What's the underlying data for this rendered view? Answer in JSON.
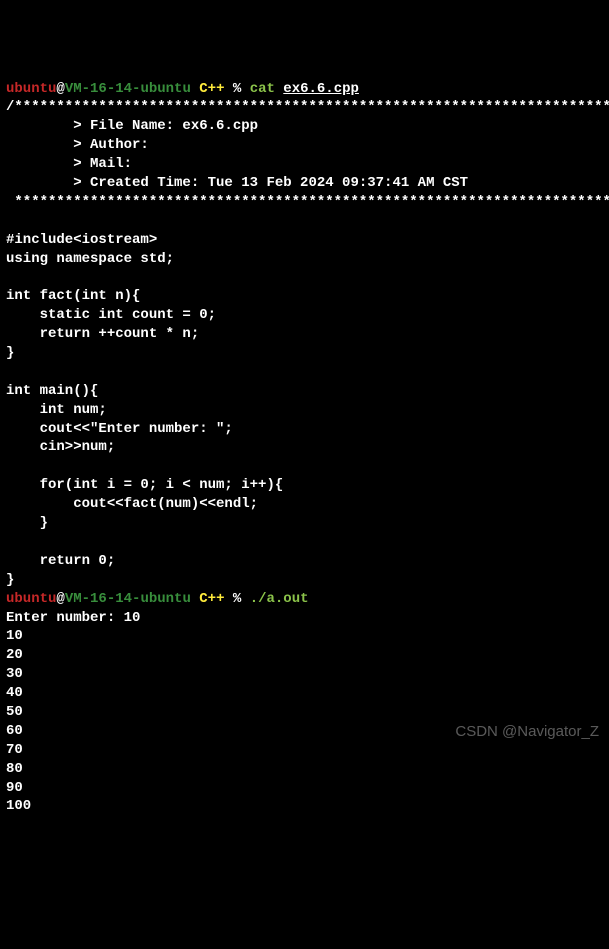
{
  "prompt1": {
    "user": "ubuntu",
    "at": "@",
    "host": "VM-16-14-ubuntu",
    "dir": " C++ ",
    "pct": "% ",
    "cmd": "cat ",
    "arg": "ex6.6.cpp"
  },
  "source": {
    "l01": "/*************************************************************************",
    "l02": "        > File Name: ex6.6.cpp",
    "l03": "        > Author:",
    "l04": "        > Mail:",
    "l05": "        > Created Time: Tue 13 Feb 2024 09:37:41 AM CST",
    "l06": " ************************************************************************/",
    "l07": "",
    "l08": "#include<iostream>",
    "l09": "using namespace std;",
    "l10": "",
    "l11": "int fact(int n){",
    "l12": "    static int count = 0;",
    "l13": "    return ++count * n;",
    "l14": "}",
    "l15": "",
    "l16": "int main(){",
    "l17": "    int num;",
    "l18": "    cout<<\"Enter number: \";",
    "l19": "    cin>>num;",
    "l20": "",
    "l21": "    for(int i = 0; i < num; i++){",
    "l22": "        cout<<fact(num)<<endl;",
    "l23": "    }",
    "l24": "",
    "l25": "    return 0;",
    "l26": "}"
  },
  "prompt2": {
    "user": "ubuntu",
    "at": "@",
    "host": "VM-16-14-ubuntu",
    "dir": " C++ ",
    "pct": "% ",
    "cmd": "./a.out"
  },
  "run": {
    "prompt_line": "Enter number: 10",
    "o01": "10",
    "o02": "20",
    "o03": "30",
    "o04": "40",
    "o05": "50",
    "o06": "60",
    "o07": "70",
    "o08": "80",
    "o09": "90",
    "o10": "100"
  },
  "watermark": "CSDN @Navigator_Z"
}
